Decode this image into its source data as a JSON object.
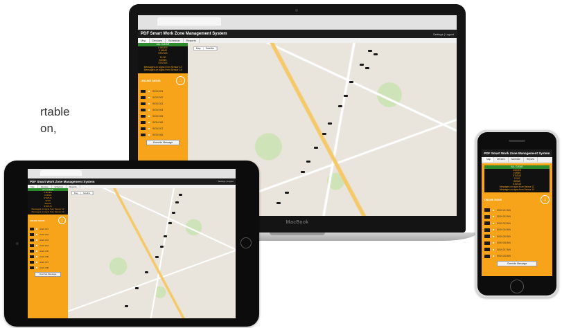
{
  "side_text": {
    "line1": "rtable",
    "line2": "on,"
  },
  "laptop": {
    "brand": "MacBook"
  },
  "app": {
    "title": "PDF Smart Work Zone Management System",
    "header_right": "Settings | Logout",
    "tabs": [
      "Map",
      "Devices",
      "Schedule",
      "Reports"
    ],
    "map_tabs": [
      "Map",
      "Satellite"
    ],
    "status": {
      "header": "ALL CLEAR",
      "lines": [
        "0 MILES",
        "0 MINS",
        "STATUS",
        "12:00",
        "SIGNS",
        "STATUS"
      ],
      "footer": [
        "Messages on signs from Sensor 12",
        "Messages on signs from Sensor 14"
      ]
    },
    "signs_header": "ONLINE SIGNS",
    "home_icon": "home-icon",
    "signs": [
      "SIGN 001",
      "SIGN 002",
      "SIGN 003",
      "SIGN 004",
      "SIGN 005",
      "SIGN 006",
      "SIGN 007",
      "SIGN 008"
    ],
    "message_button": "Override Message"
  },
  "phone_app": {
    "title": "PDF Smart Work Zone Management System",
    "tabs": [
      "Map",
      "Devices",
      "Schedule",
      "Reports"
    ],
    "status": {
      "header": "ALL CLEAR",
      "lines": [
        "0 MILES",
        "0 MINS",
        "STATUS",
        "12:00",
        "SIGNS",
        "STATUS"
      ],
      "footer": [
        "Messages on signs from Sensor 12",
        "Messages on signs from Sensor 14"
      ]
    },
    "signs_header": "ONLINE SIGNS",
    "signs": [
      "SIGN 001 MN",
      "SIGN 002 MN",
      "SIGN 003 MN",
      "SIGN 004 MN",
      "SIGN 005 MN",
      "SIGN 006 MN",
      "SIGN 007 MN",
      "SIGN 008 MN"
    ],
    "message_button": "Override Message"
  },
  "colors": {
    "accent": "#f7a41a",
    "bar": "#1d1d1d",
    "ok": "#2d8a2d"
  }
}
